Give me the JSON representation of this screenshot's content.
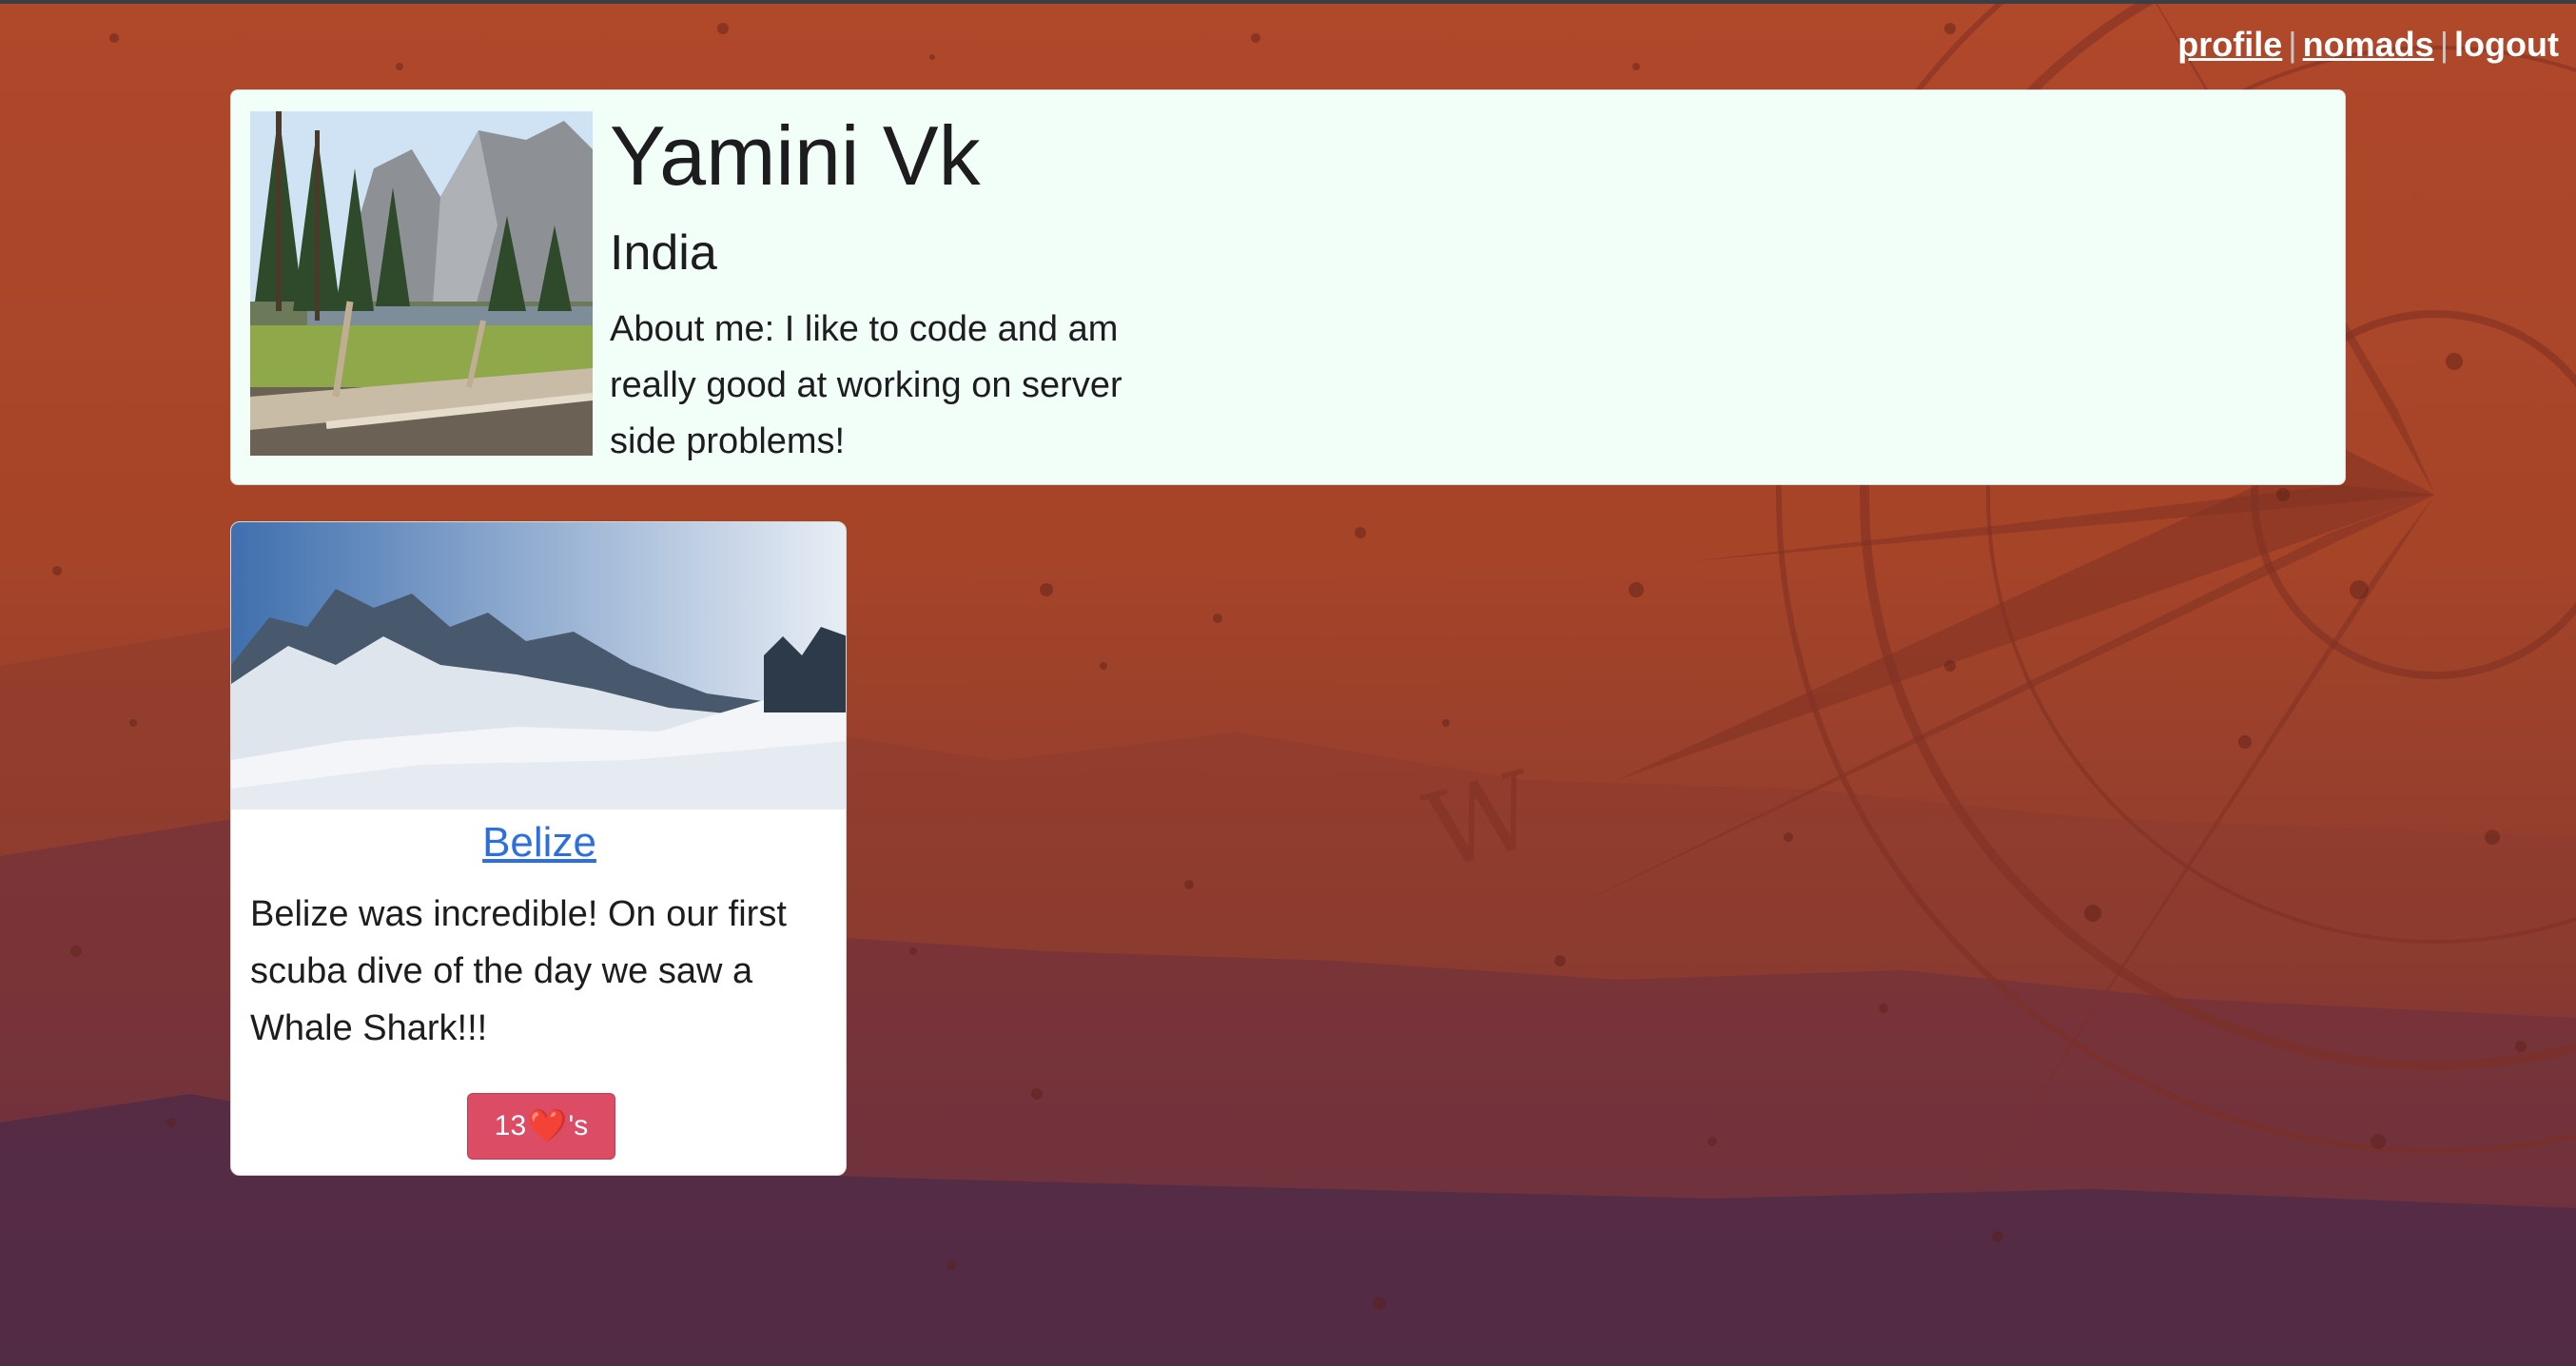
{
  "nav": {
    "profile_label": "profile",
    "separator": "|",
    "nomads_label": "nomads",
    "logout_label": "logout"
  },
  "profile": {
    "name": "Yamini Vk",
    "country": "India",
    "about": "About me: I like to code and am really good at working on server side problems!",
    "photo_icon": "forest-mountain-photo"
  },
  "posts": [
    {
      "title": "Belize",
      "body": "Belize was incredible! On our first scuba dive of the day we saw a Whale Shark!!!",
      "likes_count": "13",
      "likes_suffix": "'s",
      "heart_glyph": "❤️",
      "photo_icon": "snowy-mountains-photo"
    }
  ],
  "colors": {
    "profile_card_bg": "#f2fff9",
    "link_blue": "#2e6fe0",
    "like_button": "#dc4c64",
    "background_top": "#b0482a",
    "background_bottom": "#3f2748"
  }
}
